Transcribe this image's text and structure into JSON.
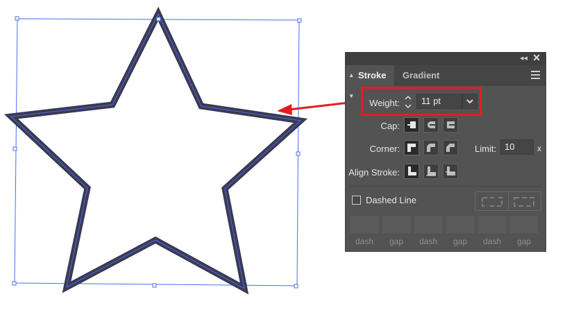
{
  "panel": {
    "collapse_icon": "double-chevron-left-icon",
    "close_icon": "close-icon",
    "tabs": [
      {
        "label": "Stroke",
        "active": true
      },
      {
        "label": "Gradient",
        "active": false
      }
    ],
    "weight": {
      "label": "Weight:",
      "value": "11 pt"
    },
    "cap": {
      "label": "Cap:",
      "options": [
        "butt-cap-icon",
        "round-cap-icon",
        "projecting-cap-icon"
      ],
      "selected": 0
    },
    "corner": {
      "label": "Corner:",
      "options": [
        "miter-join-icon",
        "round-join-icon",
        "bevel-join-icon"
      ],
      "selected": 0
    },
    "limit": {
      "label": "Limit:",
      "value": "10",
      "suffix": "x"
    },
    "align_stroke": {
      "label": "Align Stroke:",
      "options": [
        "align-center-icon",
        "align-inside-icon",
        "align-outside-icon"
      ],
      "selected": 0
    },
    "dashed_line": {
      "label": "Dashed Line",
      "checked": false
    },
    "dash_gap_labels": [
      "dash",
      "gap",
      "dash",
      "gap",
      "dash",
      "gap"
    ]
  },
  "colors": {
    "star_stroke": "#3b3a52",
    "selection": "#4a6cf0",
    "highlight": "#e31d1d",
    "panel_bg": "#535353"
  }
}
